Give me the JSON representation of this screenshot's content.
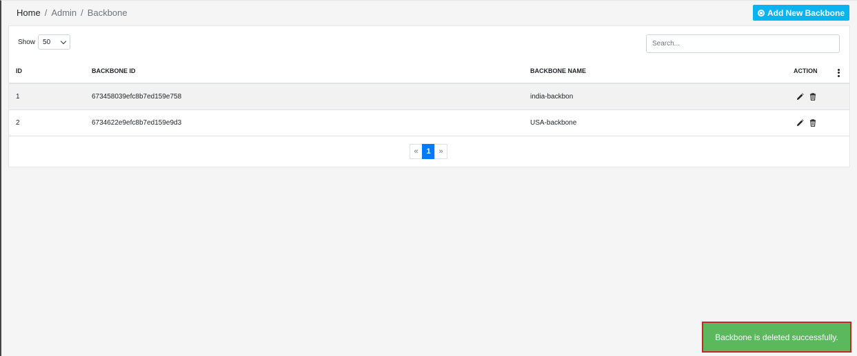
{
  "breadcrumb": {
    "home": "Home",
    "sep1": "/",
    "admin": "Admin",
    "sep2": "/",
    "current": "Backbone"
  },
  "header": {
    "add_button_label": "Add New Backbone"
  },
  "controls": {
    "show_label": "Show",
    "show_value": "50",
    "search_placeholder": "Search..."
  },
  "table": {
    "columns": [
      "ID",
      "BACKBONE ID",
      "BACKBONE NAME",
      "ACTION"
    ],
    "rows": [
      {
        "id": "1",
        "backbone_id": "673458039efc8b7ed159e758",
        "backbone_name": "india-backbon"
      },
      {
        "id": "2",
        "backbone_id": "6734622e9efc8b7ed159e9d3",
        "backbone_name": "USA-backbone"
      }
    ]
  },
  "pagination": {
    "prev": "«",
    "current": "1",
    "next": "»"
  },
  "toast": {
    "message": "Backbone is deleted successfully."
  },
  "colors": {
    "accent": "#0bb3f0",
    "primary": "#007bff",
    "success": "#5cb85c",
    "highlight_border": "#c0282c"
  }
}
